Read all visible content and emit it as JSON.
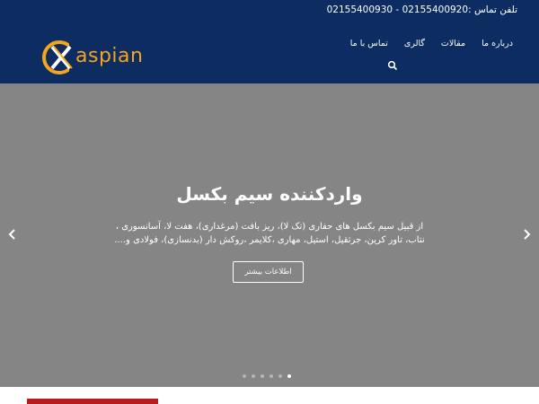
{
  "header": {
    "phone_text": "تلفن تماس :02155400920 - 02155400930",
    "logo_text": "aspian",
    "nav": [
      "تماس با ما",
      "گالری",
      "مقالات",
      "درباره ما"
    ],
    "search_icon": "search-icon"
  },
  "hero": {
    "title": "واردکننده سیم بکسل",
    "text": "از قبیل سیم بکسل های حفاری (تک لا)، ریز بافت (مرغداری)، هفت لا، آسانسوری ، نتاب، تاور کرین، جرثقیل، استیل، مهاری ،کلایمر ،روکش دار (بدنسازی)، فولادی و....",
    "button_label": "اطلاعات بیشتر",
    "dots_total": 6,
    "active_dot": 6
  },
  "colors": {
    "header_bg": "#0c2c62",
    "accent": "#f5a51d",
    "hero_bg": "#858585"
  }
}
